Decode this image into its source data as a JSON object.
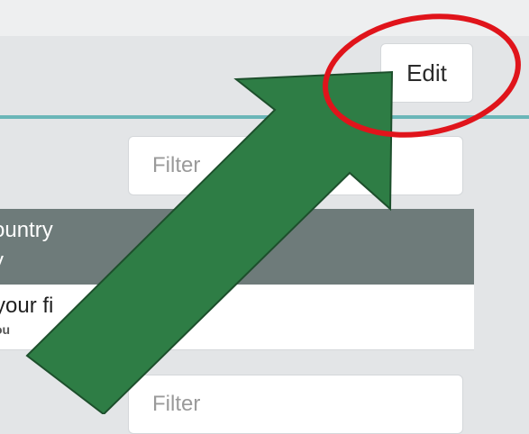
{
  "header": {
    "edit_label": "Edit"
  },
  "filters": [
    {
      "placeholder": "Filter"
    },
    {
      "placeholder": "Filter"
    }
  ],
  "table": {
    "header_line1": "ountry",
    "header_line2": "y",
    "row_main": "your fi",
    "row_sub": "ou"
  },
  "colors": {
    "teal_divider": "#6ab6b8",
    "header_bg": "#6e7b7a",
    "annotation_circle": "#e0141b",
    "annotation_arrow": "#2e7d45"
  }
}
